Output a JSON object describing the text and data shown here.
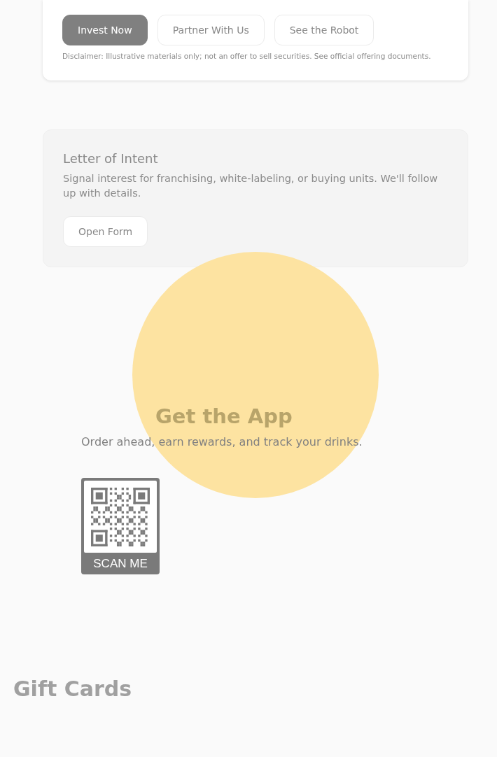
{
  "invest_card": {
    "buttons": [
      {
        "label": "Invest Now",
        "kind": "primary"
      },
      {
        "label": "Partner With Us",
        "kind": "secondary"
      },
      {
        "label": "See the Robot",
        "kind": "secondary"
      }
    ],
    "disclaimer": "Disclaimer: Illustrative materials only; not an offer to sell securities. See official offering documents."
  },
  "letter_card": {
    "title": "Letter of Intent",
    "text": "Signal interest for franchising, white-labeling, or buying units. We'll follow up with details.",
    "button": "Open Form"
  },
  "app_section": {
    "title": "Get the App",
    "text": "Order ahead, earn rewards, and track your drinks.",
    "qr_label": "SCAN ME"
  },
  "next_section": {
    "title": "Gift Cards"
  }
}
